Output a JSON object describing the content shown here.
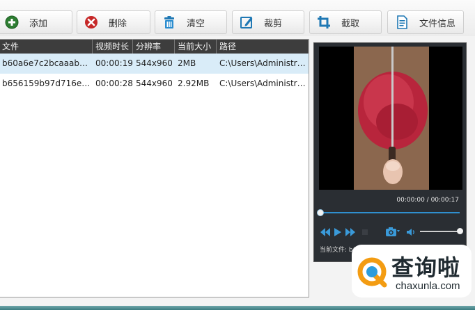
{
  "toolbar": {
    "add_label": "添加",
    "delete_label": "删除",
    "clear_label": "清空",
    "crop_label": "裁剪",
    "cut_label": "截取",
    "info_label": "文件信息"
  },
  "file_list": {
    "columns": [
      "文件",
      "视频时长",
      "分辨率",
      "当前大小",
      "路径"
    ],
    "rows": [
      {
        "name": "b60a6e7c2bcaaabe3...",
        "duration": "00:00:19",
        "resolution": "544x960",
        "size": "2MB",
        "path": "C:\\Users\\Administra...",
        "selected": true
      },
      {
        "name": "b656159b97d716ebb...",
        "duration": "00:00:28",
        "resolution": "544x960",
        "size": "2.92MB",
        "path": "C:\\Users\\Administra...",
        "selected": false
      }
    ]
  },
  "player": {
    "time": "00:00:00 / 00:00:17",
    "progress": 0,
    "volume": 1,
    "current_file": "当前文件: b60a6e7c2bc ...  ...  00  ...  93"
  },
  "watermark": {
    "title": "查询啦",
    "url": "chaxunla.com"
  },
  "colors": {
    "list_header_bg": "#3d3d3d",
    "selected_row_bg": "#d9ecf8",
    "player_bg": "#2a2e33",
    "accent_blue": "#2f8fcf",
    "add_green": "#2e7d32",
    "delete_red": "#c62828",
    "icon_blue": "#1f78b4"
  },
  "icons": {
    "add": "plus-circle-icon",
    "delete": "x-circle-icon",
    "clear": "trash-icon",
    "crop": "edit-icon",
    "cut": "crop-icon",
    "info": "document-icon"
  }
}
